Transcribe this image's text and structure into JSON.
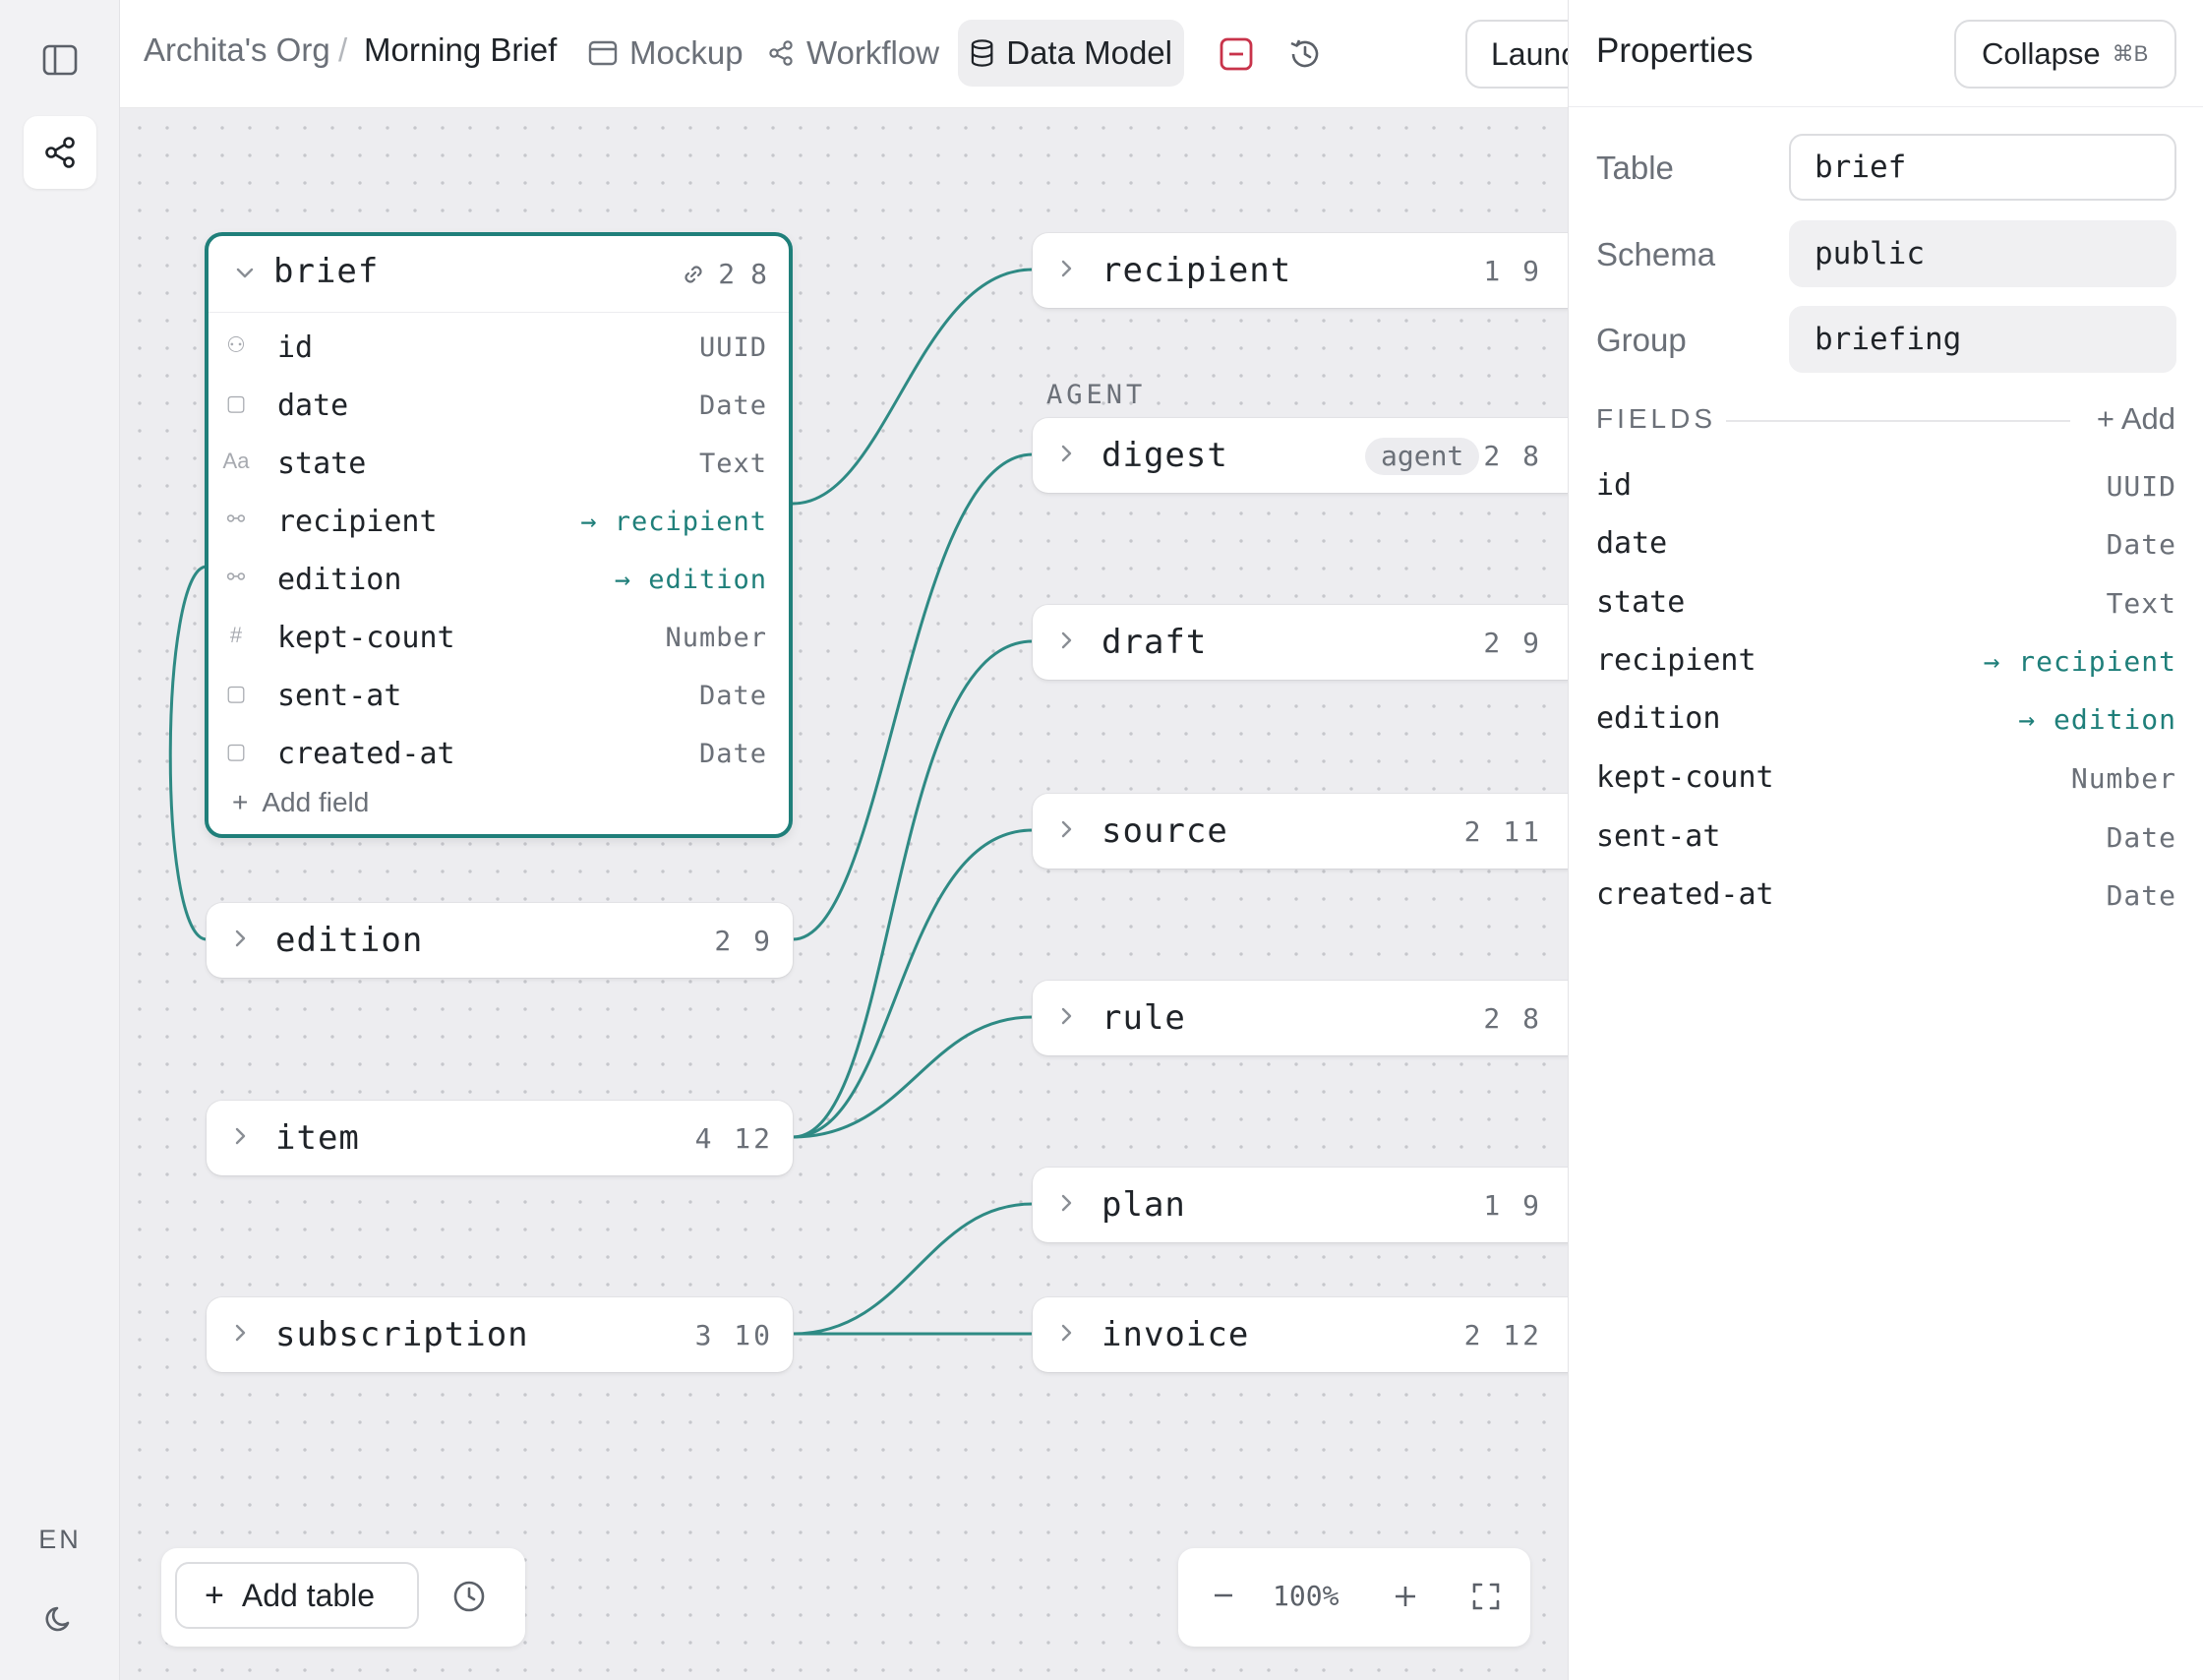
{
  "breadcrumb": {
    "org": "Archita's Org",
    "sep": "/",
    "project": "Morning Brief"
  },
  "tabs": [
    {
      "label": "Mockup",
      "icon": "window-icon"
    },
    {
      "label": "Workflow",
      "icon": "share-nodes-icon"
    },
    {
      "label": "Data Model",
      "icon": "database-icon",
      "active": true
    }
  ],
  "toolbar": {
    "launch_label": "Launch"
  },
  "rail": {
    "lang": "EN"
  },
  "brief": {
    "name": "brief",
    "links": "2",
    "fields_count": "8",
    "fields": [
      {
        "icon": "⚇",
        "name": "id",
        "type": "UUID"
      },
      {
        "icon": "▢",
        "name": "date",
        "type": "Date"
      },
      {
        "icon": "Aa",
        "name": "state",
        "type": "Text"
      },
      {
        "icon": "⚯",
        "name": "recipient",
        "type": "→ recipient",
        "link": true
      },
      {
        "icon": "⚯",
        "name": "edition",
        "type": "→ edition",
        "link": true
      },
      {
        "icon": "#",
        "name": "kept-count",
        "type": "Number"
      },
      {
        "icon": "▢",
        "name": "sent-at",
        "type": "Date"
      },
      {
        "icon": "▢",
        "name": "created-at",
        "type": "Date"
      }
    ],
    "add_field": "Add field"
  },
  "nodes_left": [
    {
      "name": "edition",
      "counts": "2 9"
    },
    {
      "name": "item",
      "counts": "4 12"
    },
    {
      "name": "subscription",
      "counts": "3 10"
    }
  ],
  "nodes_right": [
    {
      "name": "recipient",
      "counts": "1 9"
    },
    {
      "name": "digest",
      "counts": "2 8",
      "badge": "agent"
    },
    {
      "name": "draft",
      "counts": "2 9"
    },
    {
      "name": "source",
      "counts": "2 11"
    },
    {
      "name": "rule",
      "counts": "2 8"
    },
    {
      "name": "plan",
      "counts": "1 9"
    },
    {
      "name": "invoice",
      "counts": "2 12"
    }
  ],
  "section_agent": "AGENT",
  "canvas_controls": {
    "add_table": "Add table",
    "zoom": "100%"
  },
  "panel": {
    "title": "Properties",
    "collapse": "Collapse",
    "collapse_kbd": "⌘B",
    "table_label": "Table",
    "table_value": "brief",
    "schema_label": "Schema",
    "schema_value": "public",
    "group_label": "Group",
    "group_value": "briefing",
    "fields_label": "FIELDS",
    "add_label": "+ Add",
    "fields": [
      {
        "name": "id",
        "type": "UUID"
      },
      {
        "name": "date",
        "type": "Date"
      },
      {
        "name": "state",
        "type": "Text"
      },
      {
        "name": "recipient",
        "type": "→ recipient",
        "link": true
      },
      {
        "name": "edition",
        "type": "→ edition",
        "link": true
      },
      {
        "name": "kept-count",
        "type": "Number"
      },
      {
        "name": "sent-at",
        "type": "Date"
      },
      {
        "name": "created-at",
        "type": "Date"
      }
    ]
  },
  "colors": {
    "accent": "#1f7f7a",
    "danger": "#c8334a",
    "canvas": "#ededf0"
  }
}
